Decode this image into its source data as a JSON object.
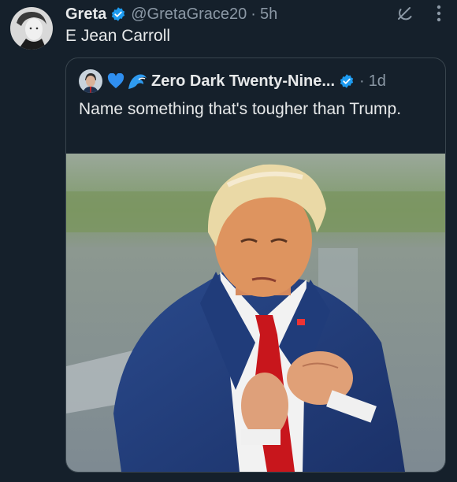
{
  "post": {
    "author_name": "Greta",
    "handle": "@GretaGrace20",
    "separator": "·",
    "time": "5h",
    "text": "E Jean Carroll",
    "more_icon": "more-vertical-icon",
    "grok_icon": "grok-icon"
  },
  "quote": {
    "author_name": "Zero Dark Twenty-Nine...",
    "separator": "·",
    "time": "1d",
    "text": "Name something that's tougher than Trump.",
    "emoji": [
      "blue-heart",
      "wave"
    ]
  },
  "colors": {
    "background": "#15202b",
    "verified": "#1d9bf0",
    "secondary_text": "#8b98a5",
    "border": "#38444d"
  }
}
